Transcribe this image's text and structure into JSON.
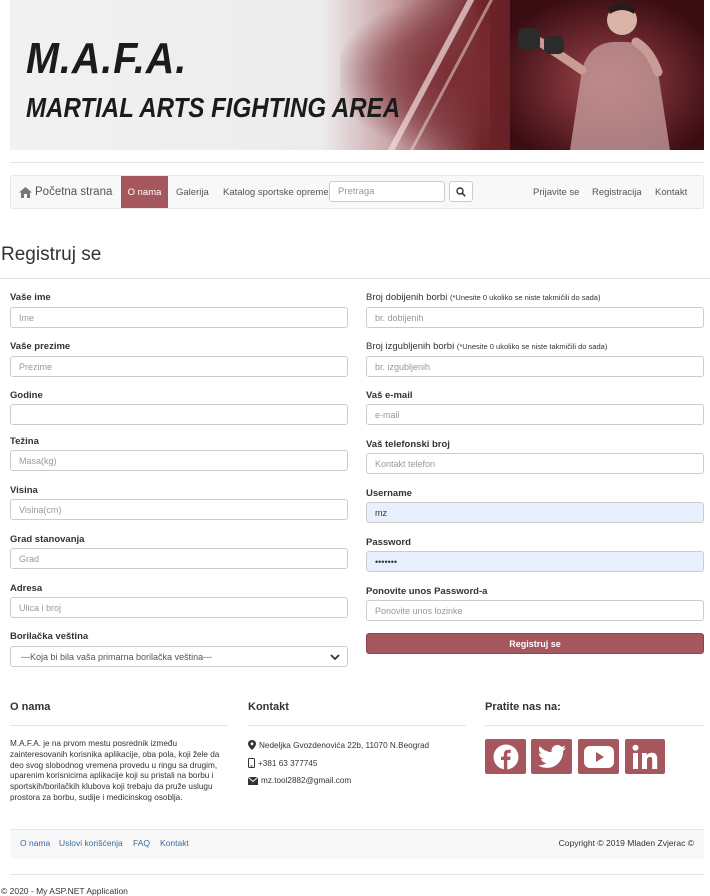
{
  "banner": {
    "title_line1": "M.A.F.A.",
    "title_line2": "MARTIAL ARTS FIGHTING AREA"
  },
  "navbar": {
    "brand": "Početna strana",
    "items": [
      "O nama",
      "Galerija",
      "Katalog sportske opreme"
    ],
    "search_placeholder": "Pretraga",
    "right_items": [
      "Prijavite se",
      "Registracija",
      "Kontakt"
    ]
  },
  "page": {
    "title": "Registruj se"
  },
  "form": {
    "left": [
      {
        "label": "Vaše ime",
        "placeholder": "Ime"
      },
      {
        "label": "Vaše prezime",
        "placeholder": "Prezime"
      },
      {
        "label": "Godine",
        "placeholder": ""
      },
      {
        "label": "Težina",
        "placeholder": "Masa(kg)"
      },
      {
        "label": "Visina",
        "placeholder": "Visina(cm)"
      },
      {
        "label": "Grad stanovanja",
        "placeholder": "Grad"
      },
      {
        "label": "Adresa",
        "placeholder": "Ulica i broj"
      },
      {
        "label": "Borilačka veština",
        "value": "---Koja bi bila vaša primarna borilačka veština---"
      }
    ],
    "right": [
      {
        "label": "Broj dobijenih borbi",
        "hint": "(*Unesite 0 ukoliko se niste takmičili do sada)",
        "placeholder": "br. dobijenih"
      },
      {
        "label": "Broj izgubljenih borbi",
        "hint": "(*Unesite 0 ukoliko se niste takmičili do sada)",
        "placeholder": "br. izgubljenih"
      },
      {
        "label": "Vaš e-mail",
        "placeholder": "e-mail"
      },
      {
        "label": "Vaš telefonski broj",
        "placeholder": "Kontakt telefon"
      },
      {
        "label": "Username",
        "value": "mz"
      },
      {
        "label": "Password",
        "value": "•••••••"
      },
      {
        "label": "Ponovite unos Password-a",
        "placeholder": "Ponovite unos lozinke"
      }
    ],
    "submit_label": "Registruj se"
  },
  "footer": {
    "about_title": "O nama",
    "about_text": "M.A.F.A. je na prvom mestu posrednik između zainteresovanih korisnika aplikacije, oba pola, koji žele da deo svog slobodnog vremena provedu u ringu sa drugim, uparenim korisnicima aplikacije koji su pristali na borbu i sportskih/borilačkih klubova koji trebaju da pruže uslugu prostora za borbu, sudije i medicinskog osoblja.",
    "contact_title": "Kontakt",
    "address": "Nedeljka Gvozdenovića 22b, 11070 N.Beograd",
    "phone": "+381 63 377745",
    "email": "mz.tool2882@gmail.com",
    "follow_title": "Pratite nas na:",
    "social_icons": [
      "facebook-icon",
      "twitter-icon",
      "youtube-icon",
      "linkedin-icon"
    ],
    "links": [
      "O nama",
      "Uslovi korišćenja",
      "FAQ",
      "Kontakt"
    ],
    "copyright": "Copyright © 2019 Mladen Zvjerac ©",
    "app_footer": "© 2020 - My ASP.NET Application"
  },
  "colors": {
    "accent": "#a6565d",
    "link": "#3b6aa0",
    "autofill": "#e8f0fe"
  }
}
